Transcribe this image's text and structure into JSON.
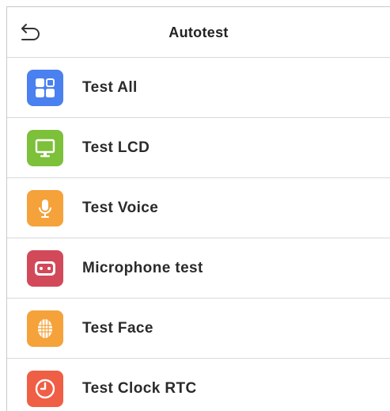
{
  "header": {
    "title": "Autotest",
    "back_icon": "back-arrow-icon"
  },
  "items": [
    {
      "label": "Test All",
      "icon": "grid-icon",
      "color": "#4a80f0"
    },
    {
      "label": "Test LCD",
      "icon": "monitor-icon",
      "color": "#7dc03a"
    },
    {
      "label": "Test Voice",
      "icon": "microphone-icon",
      "color": "#f5a23b"
    },
    {
      "label": "Microphone test",
      "icon": "cassette-icon",
      "color": "#d2495a"
    },
    {
      "label": "Test Face",
      "icon": "face-icon",
      "color": "#f5a23b"
    },
    {
      "label": "Test Clock RTC",
      "icon": "clock-icon",
      "color": "#ef5f45"
    }
  ]
}
